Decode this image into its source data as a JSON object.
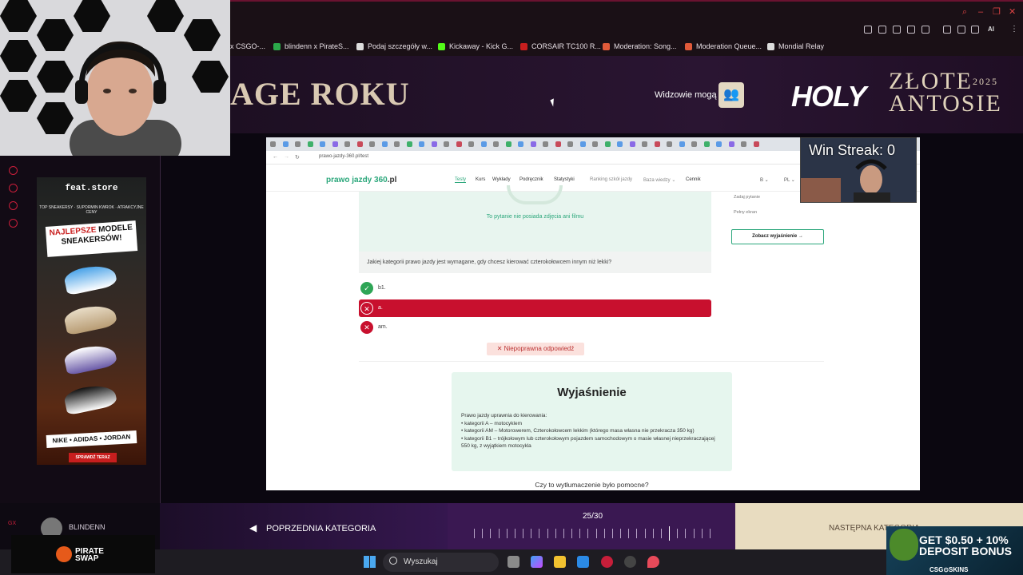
{
  "bookmarks": [
    {
      "label": "x CSGO-...",
      "color": "#888888"
    },
    {
      "label": "blindenn x PirateS...",
      "color": "#2ba84a"
    },
    {
      "label": "Podaj szczegóły w...",
      "color": "#dddddd"
    },
    {
      "label": "Kickaway - Kick G...",
      "color": "#53fc18"
    },
    {
      "label": "CORSAIR TC100 R...",
      "color": "#c81e1e"
    },
    {
      "label": "Moderation: Song...",
      "color": "#e05a3a"
    },
    {
      "label": "Moderation Queue...",
      "color": "#e05a3a"
    },
    {
      "label": "Mondial Relay",
      "color": "#dddddd"
    }
  ],
  "toolbar_ai": "AI",
  "banner": {
    "title": "AGE ROKU",
    "viewers_label": "Widzowie mogą",
    "viewers_icon": "people-icon",
    "holy": "HOLY",
    "event_line1": "ZŁOTE",
    "event_year": "2025",
    "event_line2": "ANTOSIE"
  },
  "ad": {
    "store": "feat.store",
    "tagline": "TOP SNEAKERSY · SUPORMIN KWROK · ATRAKCYJNE CENY",
    "headline_red": "NAJLEPSZE",
    "headline_rest": "MODELE SNEAKERSÓW!",
    "brands": "NIKE • ADIDAS • JORDAN",
    "cta": "SPRAWDŹ TERAZ"
  },
  "quiz_page": {
    "url": "prawo-jazdy-360.pl/test",
    "logo_main": "prawo jazdy 360",
    "logo_suffix": ".pl",
    "nav": [
      "Testy",
      "Kurs",
      "Wykłady",
      "Podręcznik",
      "Statystyki",
      "Ranking szkół jazdy",
      "Baza wiedzy ⌄",
      "Cennik"
    ],
    "lang": "B ⌄",
    "country": "PL ⌄",
    "no_photo": "To pytanie nie posiada zdjęcia ani filmu",
    "question": "Jakiej kategorii prawo jazdy jest wymagane, gdy chcesz kierować czterokołowcem innym niż lekki?",
    "answers": [
      {
        "label": "b1.",
        "status": "correct"
      },
      {
        "label": "a.",
        "status": "selected-wrong"
      },
      {
        "label": "am.",
        "status": "wrong"
      }
    ],
    "result": "✕ Niepoprawna odpowiedź",
    "side_ask": "Zadaj pytanie",
    "side_full": "Pełny ekran",
    "see_explanation": "Zobacz wyjaśnienie →",
    "explanation_title": "Wyjaśnienie",
    "explanation_intro": "Prawo jazdy uprawnia do kierowania:",
    "explanation_items": [
      "kategorii A – motocyklem",
      "kategorii AM – Motorowerem, Czterokołowcem lekkim (którego masa własna nie przekracza 350 kg)",
      "kategorii B1 – trójkołowym lub czterokołowym pojazdem samochodowym o masie własnej nieprzekraczającej 550 kg, z wyjątkiem motocykla"
    ],
    "helpful": "Czy to wytłumaczenie było pomocne?"
  },
  "overlay": {
    "win_streak": "Win Streak: 0"
  },
  "bottom": {
    "gx": "GX",
    "username": "BLINDENN",
    "prev_label": "POPRZEDNIA KATEGORIA",
    "progress": "25/30",
    "progress_value": 0.8333,
    "next_label": "NASTĘPNA KATEGORIA →"
  },
  "pirate": {
    "line1": "PIRATE",
    "line2": "SWAP"
  },
  "taskbar": {
    "search_label": "Wyszukaj"
  },
  "promo": {
    "line1": "GET $0.50 + 10%",
    "line2": "DEPOSIT BONUS",
    "brand": "CSG⊙SKINS"
  },
  "colors": {
    "accent_green": "#2ba77b",
    "wrong_red": "#c8102e",
    "streamer_red": "#c81e3a"
  }
}
